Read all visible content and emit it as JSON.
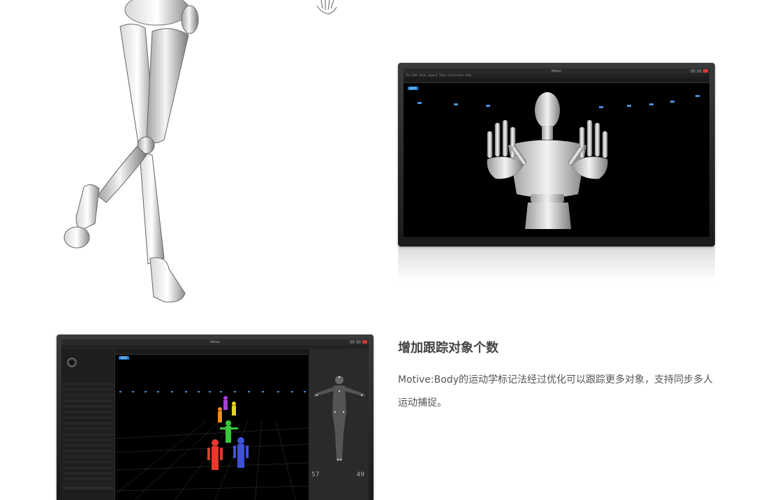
{
  "feature": {
    "title": "增加跟踪对象个数",
    "description": "Motive:Body的运动学标记法经过优化可以跟踪更多对象，支持同步多人运动捕捉。"
  },
  "monitor_top": {
    "window_title": "Motive",
    "menu_items": [
      "File",
      "Edit",
      "View",
      "Layout",
      "Tools",
      "Commands",
      "Help"
    ],
    "edit_label": "EDIT"
  },
  "monitor_bottom": {
    "window_title": "Motive",
    "edit_label": "EDIT",
    "left_count": "57",
    "right_count": "49"
  },
  "colors": {
    "accent": "#1d7dd6",
    "figure_red": "#e53a2e",
    "figure_blue": "#3c52d8",
    "figure_green": "#36c93a",
    "figure_orange": "#f08c1c",
    "figure_purple": "#a640d8",
    "figure_yellow": "#e3d41d"
  }
}
